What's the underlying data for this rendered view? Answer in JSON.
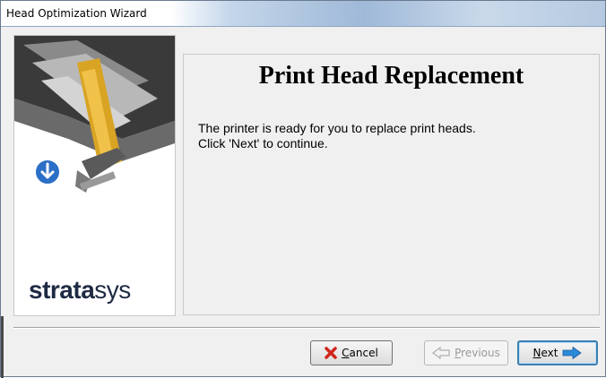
{
  "window": {
    "title": "Head Optimization Wizard"
  },
  "sidebar": {
    "brand_bold": "strata",
    "brand_light": "sys"
  },
  "main": {
    "heading": "Print Head Replacement",
    "message_line1": "The printer is ready for you to replace print heads.",
    "message_line2": "Click 'Next' to continue."
  },
  "buttons": {
    "cancel": {
      "mnemonic": "C",
      "rest": "ancel",
      "enabled": true
    },
    "previous": {
      "mnemonic": "P",
      "rest": "revious",
      "enabled": false
    },
    "next": {
      "mnemonic": "N",
      "rest": "ext",
      "enabled": true,
      "default": true
    }
  },
  "icons": {
    "cancel": "red-x-icon",
    "previous": "left-arrow-icon",
    "next": "right-arrow-icon",
    "step": "down-arrow-circle-icon"
  },
  "colors": {
    "titlebar_accent": "#9fb9d8",
    "cancel_icon": "#d0261c",
    "next_arrow": "#2a8ad8",
    "step_circle": "#2b6fc6"
  }
}
